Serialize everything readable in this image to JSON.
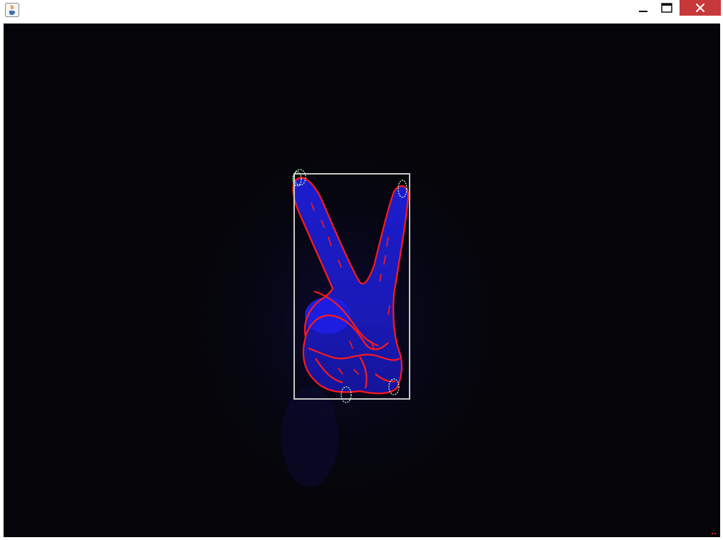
{
  "window": {
    "title": "",
    "icon": "java-cup-icon",
    "controls": {
      "minimize": "minimize-icon",
      "maximize": "maximize-icon",
      "close": "close-icon"
    },
    "colors": {
      "close_button": "#c7383b",
      "titlebar": "#ffffff"
    }
  },
  "viewport": {
    "description_colors": {
      "background": "#050509",
      "hand_fill": "#1a1acc",
      "contour": "#ff1a1a",
      "bounding_box": "#c8c8c8",
      "fingertip_markers": "#c8ffc8"
    },
    "detected": {
      "gesture_contour": "hand-contour",
      "bounding_box": "hand-bounding-box",
      "fingertip_count": 4
    }
  }
}
